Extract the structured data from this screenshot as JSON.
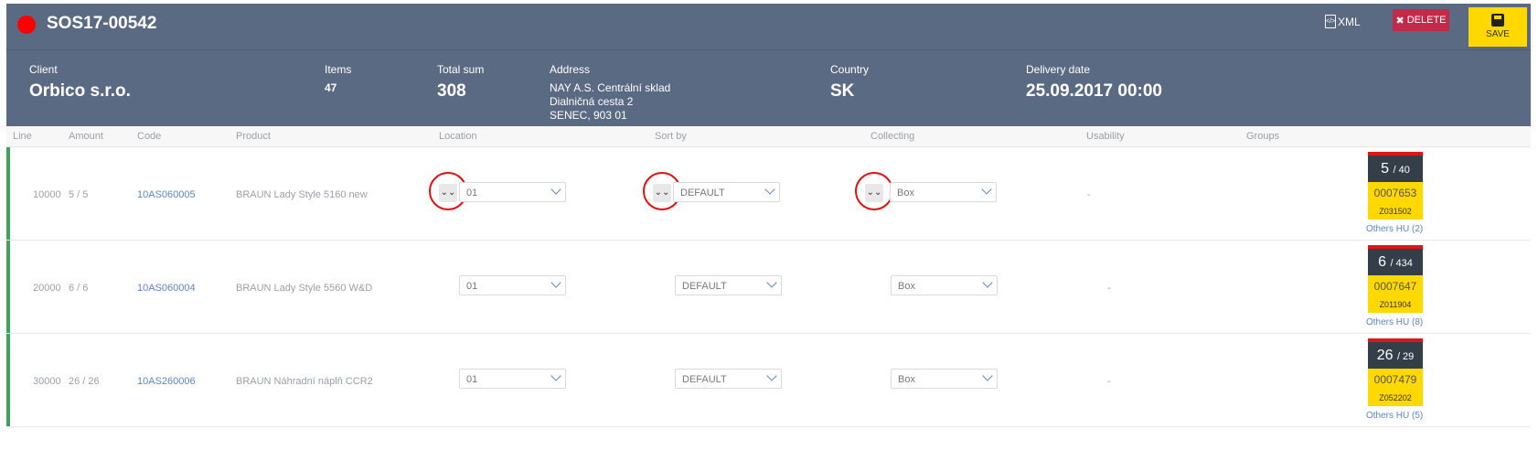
{
  "header": {
    "order_no": "SOS17-00542",
    "xml_label": "XML",
    "delete_label": "DELETE",
    "save_label": "SAVE",
    "status_color": "#ff0000"
  },
  "info": {
    "client_label": "Client",
    "client_value": "Orbico s.r.o.",
    "items_label": "Items",
    "items_value": "47",
    "total_label": "Total sum",
    "total_value": "308",
    "address_label": "Address",
    "address_lines": [
      "NAY A.S. Centrální sklad",
      "Dialničná cesta 2",
      "SENEC, 903 01"
    ],
    "country_label": "Country",
    "country_value": "SK",
    "delivery_label": "Delivery date",
    "delivery_value": "25.09.2017 00:00"
  },
  "columns": [
    "Line",
    "Amount",
    "Code",
    "Product",
    "Location",
    "Sort by",
    "Collecting",
    "Usability",
    "Groups"
  ],
  "rows": [
    {
      "line": "10000",
      "amount": "5 / 5",
      "code": "10AS060005",
      "product": "BRAUN Lady Style 5160 new",
      "location": "01",
      "sort_by": "DEFAULT",
      "collecting": "Box",
      "usability": "-",
      "hu_count": "5",
      "hu_total": "/ 40",
      "hu_code": "0007653",
      "hu_zone": "Z031502",
      "others": "Others HU (2)"
    },
    {
      "line": "20000",
      "amount": "6 / 6",
      "code": "10AS060004",
      "product": "BRAUN Lady Style 5560 W&D",
      "location": "01",
      "sort_by": "DEFAULT",
      "collecting": "Box",
      "usability": "-",
      "hu_count": "6",
      "hu_total": "/ 434",
      "hu_code": "0007647",
      "hu_zone": "Z011904",
      "others": "Others HU (8)"
    },
    {
      "line": "30000",
      "amount": "26 / 26",
      "code": "10AS260006",
      "product": "BRAUN Náhradní náplň CCR2",
      "location": "01",
      "sort_by": "DEFAULT",
      "collecting": "Box",
      "usability": "-",
      "hu_count": "26",
      "hu_total": "/ 29",
      "hu_code": "0007479",
      "hu_zone": "Z052202",
      "others": "Others HU (5)"
    }
  ],
  "expander_icon": "double-chevron-down-icon",
  "colors": {
    "header_bg": "#5b6a83",
    "accent_yellow": "#ffd800",
    "delete_red": "#c2294a",
    "link_blue": "#5b86bf",
    "row_marker_green": "#3da35d"
  }
}
